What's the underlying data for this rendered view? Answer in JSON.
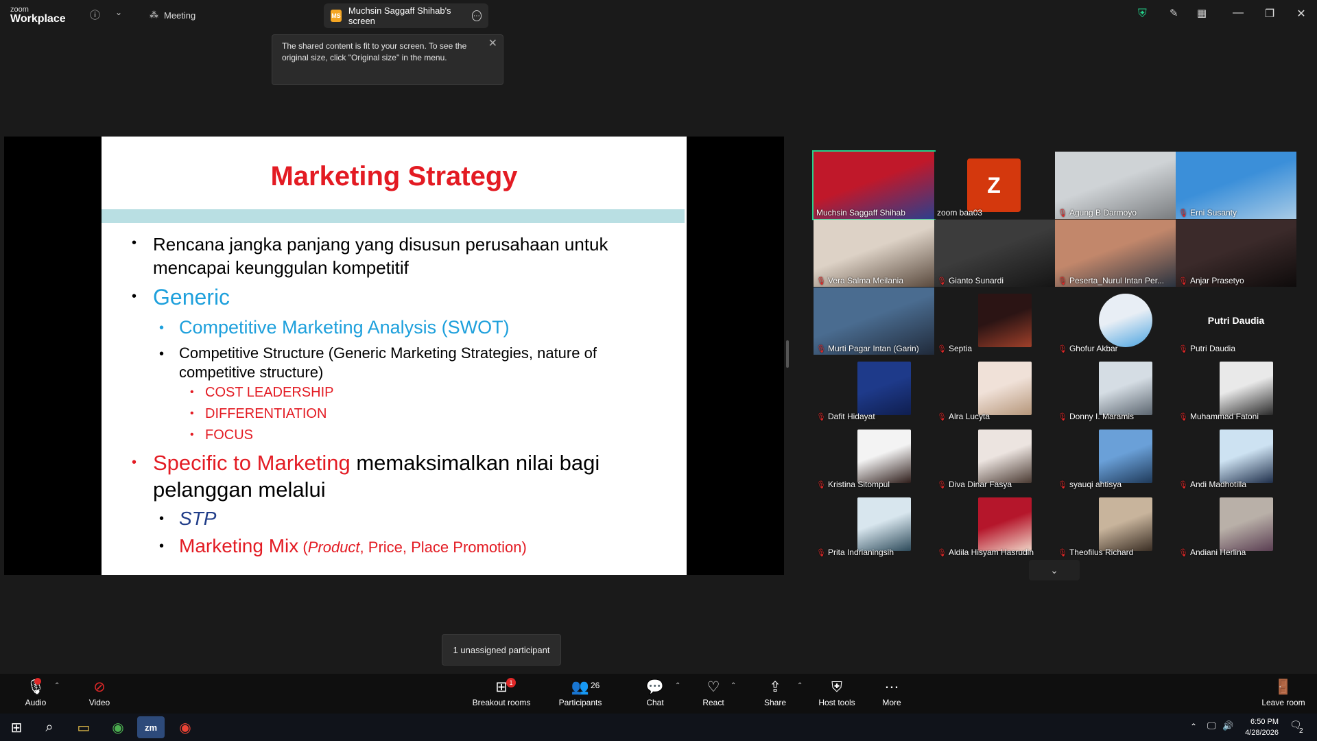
{
  "app": {
    "brand_small": "zoom",
    "brand_big": "Workplace",
    "meeting_tab": "Meeting",
    "share_tab": "Muchsin Saggaff Shihab's screen",
    "share_badge": "MS"
  },
  "tooltip": {
    "text": "The shared content is fit to your screen. To see the original size, click \"Original size\" in the menu."
  },
  "slide": {
    "title": "Marketing Strategy",
    "b1": "Rencana jangka panjang yang disusun perusahaan untuk",
    "b1b": "mencapai keunggulan kompetitif",
    "b2": "Generic",
    "b2a": "Competitive Marketing Analysis (SWOT)",
    "b2b": "Competitive Structure (Generic Marketing Strategies, nature of",
    "b2b2": "competitive structure)",
    "b2c1": "COST LEADERSHIP",
    "b2c2": "DIFFERENTIATION",
    "b2c3": "FOCUS",
    "b3a": "Specific to Marketing",
    "b3b": " memaksimalkan nilai bagi",
    "b3c": "pelanggan melalui",
    "b3d": "STP",
    "b3e": "Marketing Mix",
    "b3f1": " (",
    "b3f2": "Product",
    "b3f3": ", Price, Place Promotion)"
  },
  "gallery": {
    "tiles": [
      {
        "name": "Muchsin Saggaff Shihab",
        "muted": false
      },
      {
        "name": "zoom baa03",
        "muted": false,
        "initial": "Z"
      },
      {
        "name": "Agung B Darmoyo",
        "muted": true
      },
      {
        "name": "Erni Susanty",
        "muted": true
      },
      {
        "name": "Vera Salma Meilania",
        "muted": true
      },
      {
        "name": "Gianto Sunardi",
        "muted": true
      },
      {
        "name": "Peserta_Nurul Intan Per...",
        "muted": true
      },
      {
        "name": "Anjar Prasetyo",
        "muted": true
      },
      {
        "name": "Murti Pagar Intan (Garin)",
        "muted": true
      },
      {
        "name": "Septia",
        "muted": true
      },
      {
        "name": "Ghofur Akbar",
        "muted": true
      },
      {
        "name": "Putri Daudia",
        "muted": true,
        "big": "Putri Daudia"
      },
      {
        "name": "Dafit Hidayat",
        "muted": true
      },
      {
        "name": "Alra Lucyta",
        "muted": true
      },
      {
        "name": "Donny I. Maramis",
        "muted": true
      },
      {
        "name": "Muhammad Fatoni",
        "muted": true
      },
      {
        "name": "Kristina Sitompul",
        "muted": true
      },
      {
        "name": "Diva Dinar Fasya",
        "muted": true
      },
      {
        "name": "syauqi ahtisya",
        "muted": true
      },
      {
        "name": "Andi Madhotilla",
        "muted": true
      },
      {
        "name": "Prita Indrianingsih",
        "muted": true
      },
      {
        "name": "Aldila Hisyam Hasrudin",
        "muted": true
      },
      {
        "name": "Theofilus Richard",
        "muted": true
      },
      {
        "name": "Andiani Herlina",
        "muted": true
      }
    ]
  },
  "unassigned": "1 unassigned participant",
  "toolbar": {
    "audio": "Audio",
    "video": "Video",
    "breakout": "Breakout rooms",
    "breakout_badge": "1",
    "participants": "Participants",
    "participants_count": "26",
    "chat": "Chat",
    "react": "React",
    "share": "Share",
    "host_tools": "Host tools",
    "more": "More",
    "leave": "Leave room"
  },
  "taskbar": {
    "time": "6:50 PM",
    "date": "4/28/2026",
    "notif": "2"
  },
  "colors": {
    "accent_green": "#23d18b",
    "mute_red": "#e02828",
    "slide_red": "#e31b23",
    "slide_blue": "#1ea0dc"
  }
}
